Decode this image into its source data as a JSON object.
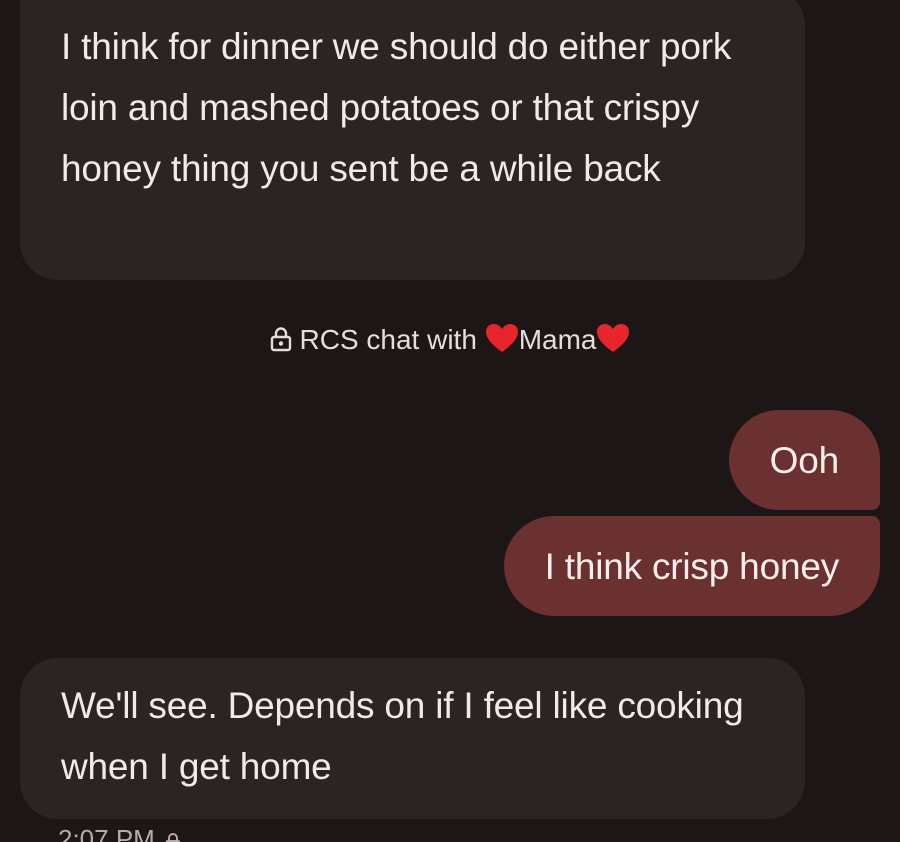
{
  "conversation": {
    "messages": [
      {
        "direction": "incoming",
        "text": "I think for dinner we should do either pork loin and mashed potatoes or that crispy honey thing you sent be a while back"
      },
      {
        "direction": "outgoing",
        "text": "Ooh"
      },
      {
        "direction": "outgoing",
        "text": "I think crisp honey"
      },
      {
        "direction": "incoming",
        "text": "We'll see. Depends on if I feel like cooking when I get home"
      }
    ],
    "chat_info": {
      "prefix": "RCS chat with",
      "contact_name": "Mama",
      "lock_icon": "lock-icon",
      "heart_icon": "red-heart-emoji"
    },
    "timestamp": {
      "text": "2:07 PM",
      "icon": "lock-icon"
    }
  },
  "colors": {
    "background": "#1c1616",
    "incoming_bubble": "#2c2424",
    "outgoing_bubble": "#6b3030",
    "heart": "#e8252b"
  }
}
